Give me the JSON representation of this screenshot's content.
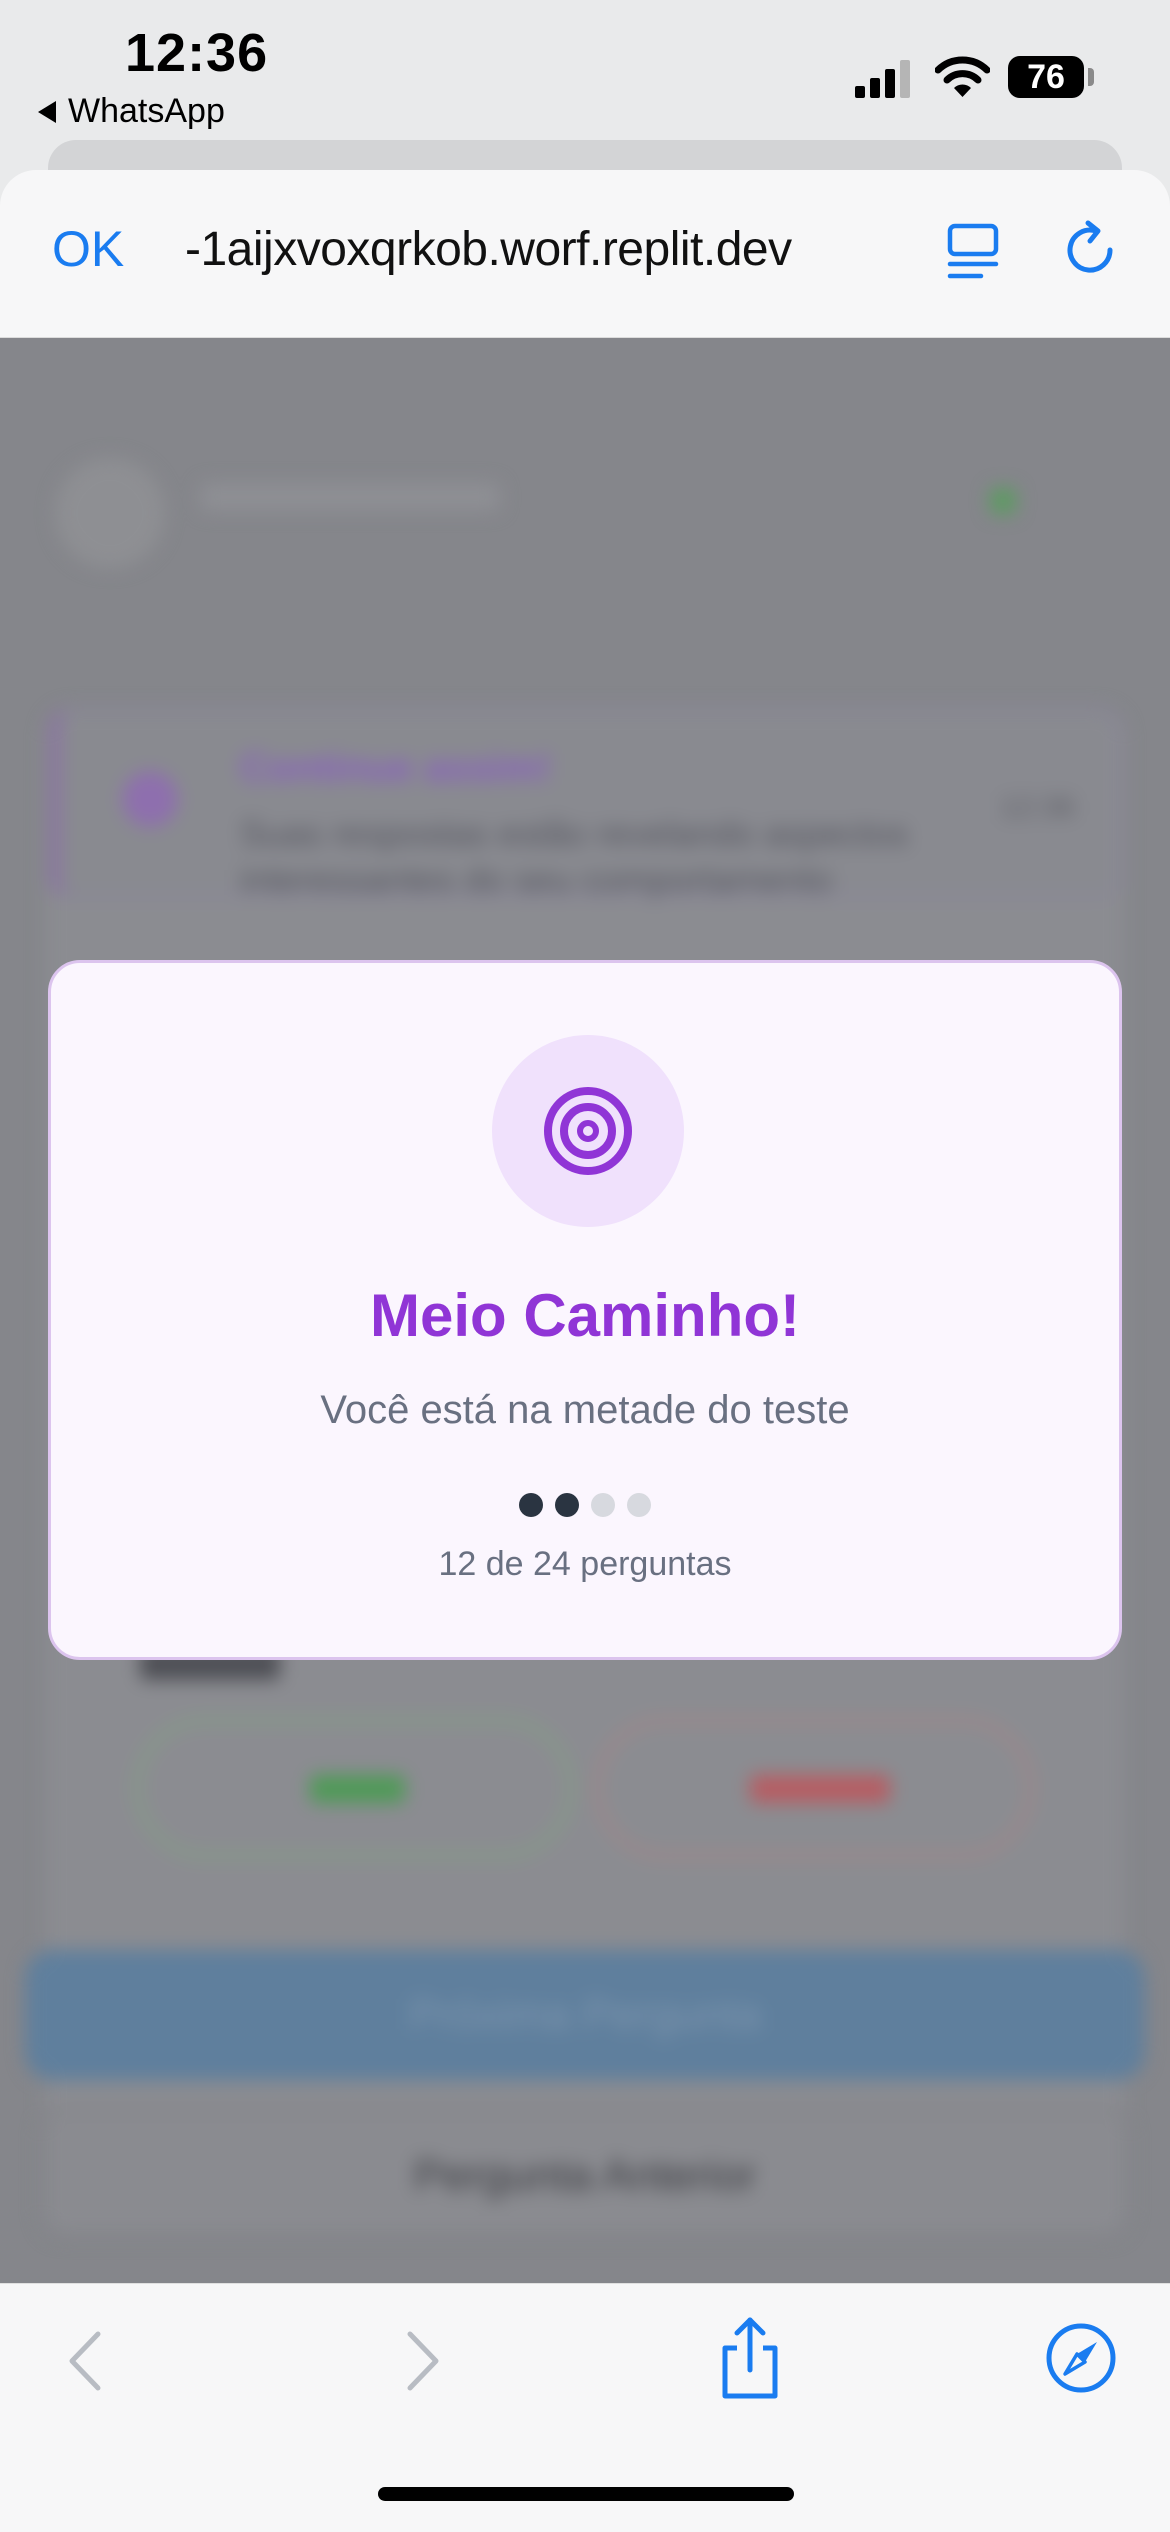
{
  "status_bar": {
    "time": "12:36",
    "back_app": "WhatsApp",
    "battery": "76"
  },
  "browser": {
    "done_label": "OK",
    "url": "-1aijxvoxqrkob.worf.replit.dev",
    "accent_color": "#1a7cf0"
  },
  "background_page": {
    "tip_title": "Continue assim!",
    "tip_text": "Suas respostas estão revelando aspectos interessantes do seu comportamento",
    "tip_time": "12:36",
    "next_button": "Próxima Pergunta",
    "prev_button": "Pergunta Anterior"
  },
  "modal": {
    "icon": "target-icon",
    "title": "Meio Caminho!",
    "subtitle": "Você está na metade do teste",
    "progress_steps_total": 4,
    "progress_steps_done": 2,
    "count_text": "12 de 24 perguntas",
    "accent_color": "#9035d6"
  },
  "toolbar": {
    "icons": [
      "chevron-left-icon",
      "chevron-right-icon",
      "share-icon",
      "compass-icon"
    ]
  }
}
